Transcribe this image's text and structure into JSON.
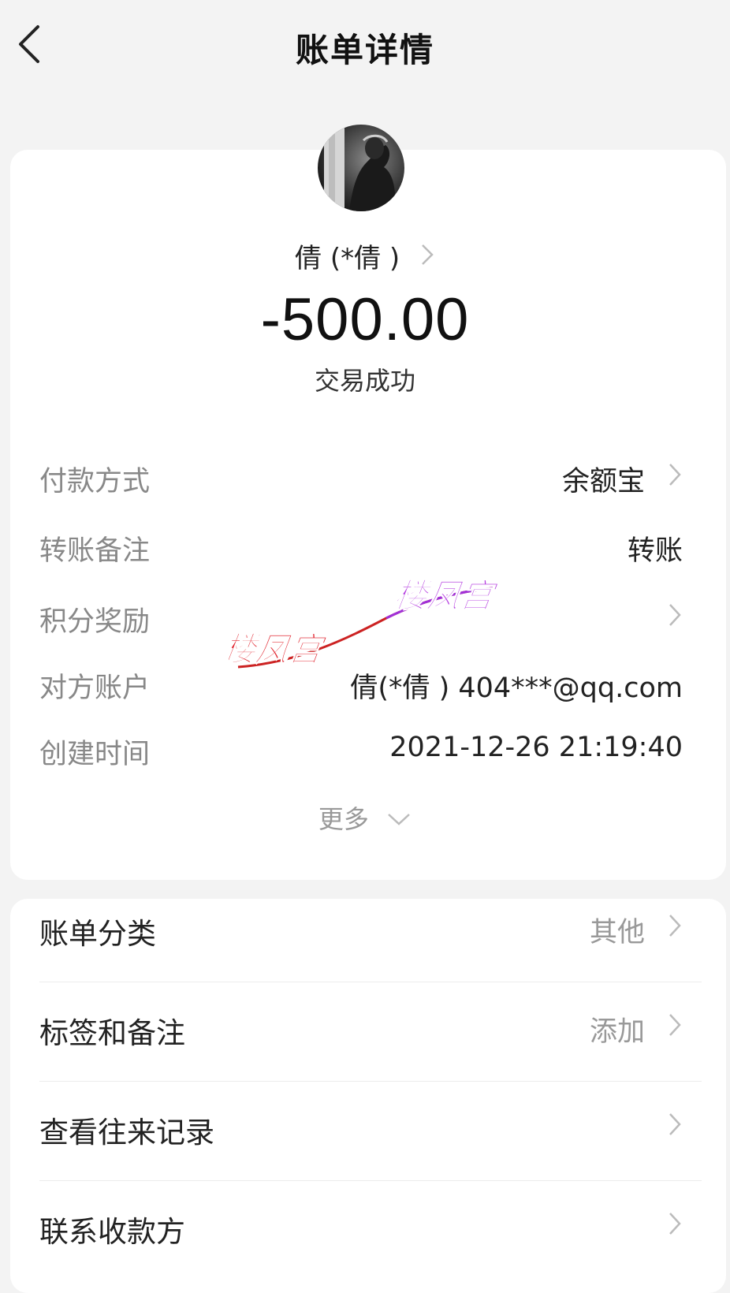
{
  "header": {
    "title": "账单详情"
  },
  "transaction": {
    "payee_name": "倩 (*倩 )",
    "amount": "-500.00",
    "status": "交易成功"
  },
  "details": {
    "payment_method": {
      "label": "付款方式",
      "value": "余额宝"
    },
    "transfer_note": {
      "label": "转账备注",
      "value": "转账"
    },
    "points_reward": {
      "label": "积分奖励",
      "value": ""
    },
    "counterparty_account": {
      "label": "对方账户",
      "value": "倩(*倩 ) 404***@qq.com"
    },
    "created_time": {
      "label": "创建时间",
      "value": "2021-12-26 21:19:40"
    },
    "more_label": "更多"
  },
  "actions": {
    "category": {
      "label": "账单分类",
      "value": "其他"
    },
    "tags": {
      "label": "标签和备注",
      "value": "添加"
    },
    "history": {
      "label": "查看往来记录"
    },
    "contact": {
      "label": "联系收款方"
    }
  },
  "watermark": {
    "text_left": "楼凤宫",
    "text_right": "楼凤宫",
    "color_left": "#e0202a",
    "color_right": "#b53de0"
  },
  "colors": {
    "background": "#f3f3f3",
    "card": "#ffffff",
    "label_gray": "#888888",
    "text_dark": "#222222"
  },
  "icons": {
    "back": "chevron-left-icon",
    "row_chevron": "chevron-right-icon",
    "more_chevron": "chevron-down-icon"
  }
}
